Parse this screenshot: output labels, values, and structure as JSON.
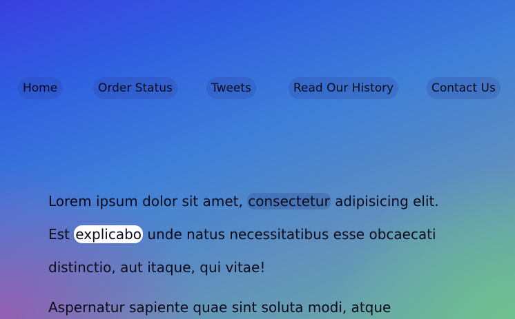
{
  "nav": {
    "items": [
      {
        "label": "Home"
      },
      {
        "label": "Order Status"
      },
      {
        "label": "Tweets"
      },
      {
        "label": "Read Our History"
      },
      {
        "label": "Contact Us"
      }
    ]
  },
  "content": {
    "paragraph1": {
      "part1": "Lorem ipsum dolor sit amet, ",
      "highlight1": "consectetur",
      "part2": " adipisicing elit.",
      "line2_start": "Est ",
      "highlight2": "explicabo",
      "line2_end": " unde natus necessitatibus esse obcaecati",
      "line3": "distinctio, aut itaque, qui vitae!"
    },
    "paragraph2": {
      "line1": "Aspernatur sapiente quae sint soluta modi, atque"
    }
  }
}
